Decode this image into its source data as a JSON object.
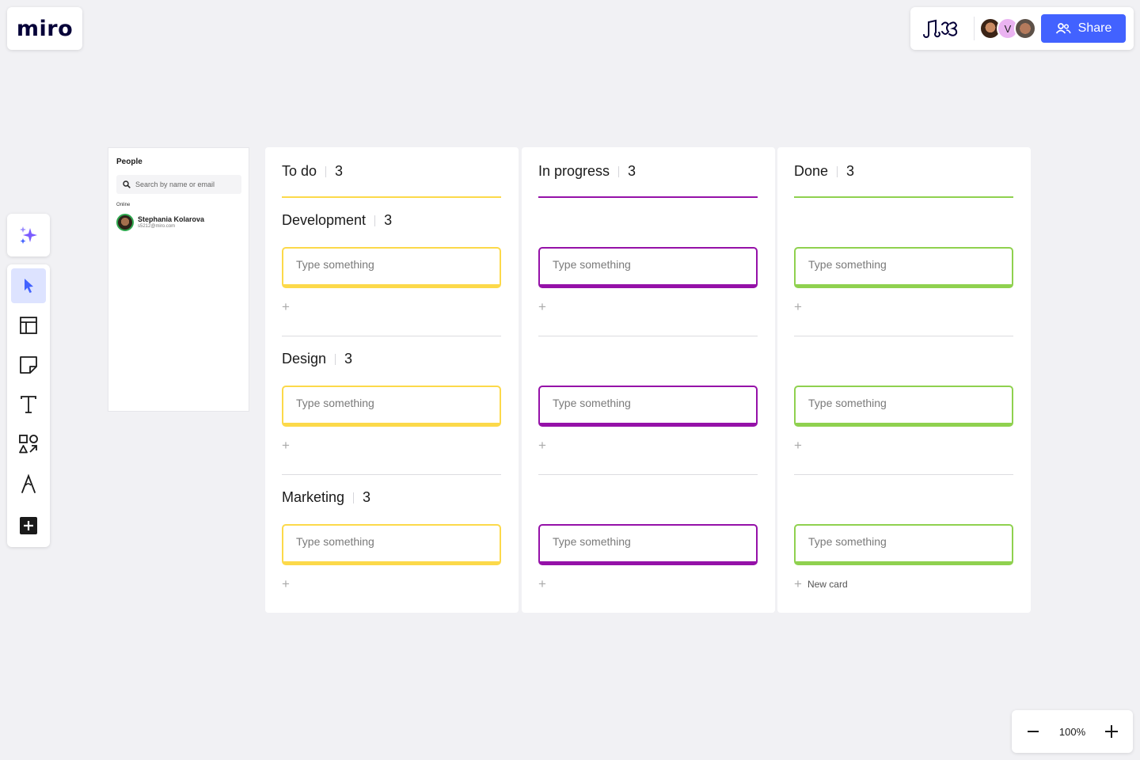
{
  "app": {
    "logo_text": "miro"
  },
  "collab": {
    "share_label": "Share",
    "avatars": [
      {
        "name": "user-photo-1",
        "initial": ""
      },
      {
        "name": "user-v",
        "initial": "V"
      },
      {
        "name": "user-photo-2",
        "initial": ""
      }
    ]
  },
  "people_panel": {
    "title": "People",
    "search_placeholder": "Search by name or email",
    "online_label": "Online",
    "person": {
      "name": "Stephania Kolarova",
      "email": "s5212@miro.com"
    }
  },
  "columns": [
    {
      "title": "To do",
      "count": "3",
      "color": "#fcd94a"
    },
    {
      "title": "In progress",
      "count": "3",
      "color": "#9511a8"
    },
    {
      "title": "Done",
      "count": "3",
      "color": "#8fd14f"
    }
  ],
  "sections": [
    {
      "title": "Development",
      "count": "3"
    },
    {
      "title": "Design",
      "count": "3"
    },
    {
      "title": "Marketing",
      "count": "3"
    }
  ],
  "card_placeholder": "Type something",
  "new_card_label": "New card",
  "zoom": {
    "value": "100%"
  },
  "colors": {
    "accent": "#4262ff",
    "todo": "#fcd94a",
    "progress": "#9511a8",
    "done": "#8fd14f"
  }
}
